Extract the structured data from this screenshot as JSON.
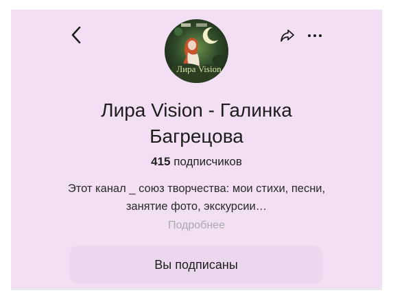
{
  "header": {
    "back_icon": "chevron-left-icon",
    "share_icon": "share-arrow-icon",
    "more_icon": "more-horizontal-icon"
  },
  "channel": {
    "name": "Лира Vision - Галинка Багрецова",
    "subscribers_count": "415",
    "subscribers_label": "подписчиков",
    "description": "Этот канал _ союз творчества:  мои стихи, песни, занятие фото, экскурсии…",
    "more_link": "Подробнее",
    "avatar_text": "Лира Vision"
  },
  "actions": {
    "subscribed_label": "Вы подписаны"
  },
  "colors": {
    "background": "#f3dff4",
    "button": "#ecd8ee",
    "muted_text": "#a9a9ad"
  }
}
